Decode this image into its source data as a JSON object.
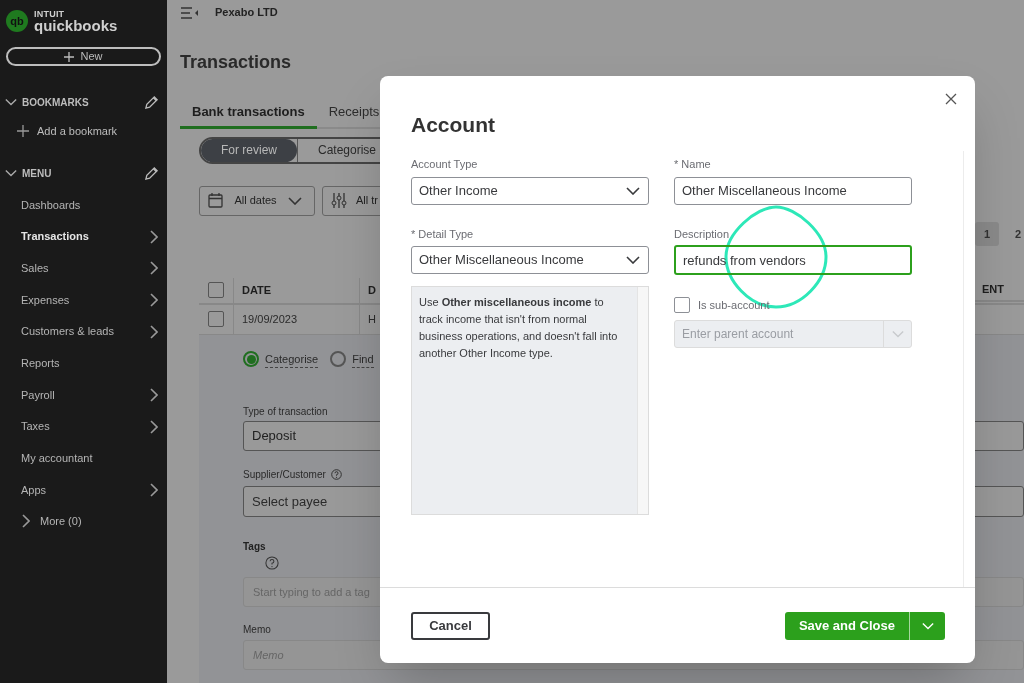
{
  "sidebar": {
    "logo": {
      "brand_small": "INTUIT",
      "brand": "quickbooks",
      "badge": "qb"
    },
    "new_button": "New",
    "bookmarks": {
      "title": "BOOKMARKS",
      "expanded": true,
      "add_label": "Add a bookmark"
    },
    "menu": {
      "title": "MENU",
      "expanded": true,
      "items": [
        {
          "label": "Dashboards",
          "selected": false,
          "has_submenu": false
        },
        {
          "label": "Transactions",
          "selected": true,
          "has_submenu": true
        },
        {
          "label": "Sales",
          "selected": false,
          "has_submenu": true
        },
        {
          "label": "Expenses",
          "selected": false,
          "has_submenu": true
        },
        {
          "label": "Customers & leads",
          "selected": false,
          "has_submenu": true
        },
        {
          "label": "Reports",
          "selected": false,
          "has_submenu": false
        },
        {
          "label": "Payroll",
          "selected": false,
          "has_submenu": true
        },
        {
          "label": "Taxes",
          "selected": false,
          "has_submenu": true
        },
        {
          "label": "My accountant",
          "selected": false,
          "has_submenu": false
        },
        {
          "label": "Apps",
          "selected": false,
          "has_submenu": true
        }
      ],
      "more": "More (0)"
    }
  },
  "topbar": {
    "company": "Pexabo LTD"
  },
  "page": {
    "title": "Transactions",
    "tabs": [
      {
        "label": "Bank transactions",
        "selected": true
      },
      {
        "label": "Receipts",
        "selected": false
      }
    ],
    "segments": [
      {
        "label": "For review",
        "selected": true
      },
      {
        "label": "Categorise",
        "selected": false
      }
    ],
    "filters": [
      {
        "label": "All dates"
      },
      {
        "label": "All tr"
      }
    ],
    "pagination": [
      {
        "label": "1",
        "selected": true
      },
      {
        "label": "2",
        "selected": false
      }
    ],
    "table": {
      "columns": [
        "DATE",
        "D"
      ],
      "right_column": "ENT",
      "all_checked": false,
      "rows": [
        {
          "checked": false,
          "cells": [
            "19/09/2023",
            "H"
          ]
        }
      ]
    },
    "detail": {
      "options": [
        {
          "label": "Categorise",
          "selected": true
        },
        {
          "label": "Find",
          "selected": false
        }
      ],
      "type_label": "Type of transaction",
      "type_value": "Deposit",
      "payee_label": "Supplier/Customer",
      "payee_placeholder": "Select payee",
      "tags_label": "Tags",
      "tags_placeholder": "Start typing to add a tag",
      "memo_label": "Memo",
      "memo_placeholder": "Memo"
    }
  },
  "dialog": {
    "title": "Account",
    "account_type": {
      "label": "Account Type",
      "value": "Other Income"
    },
    "detail_type": {
      "label": "* Detail Type",
      "value": "Other Miscellaneous Income"
    },
    "help_text": "Use **Other miscellaneous income** to track income that isn't from normal business operations, and doesn't fall into another Other Income type.",
    "name": {
      "label": "* Name",
      "value": "Other Miscellaneous Income"
    },
    "description": {
      "label": "Description",
      "value": "refunds from vendors",
      "focused": true
    },
    "sub_account": {
      "label": "Is sub-account",
      "checked": false
    },
    "parent_account": {
      "placeholder": "Enter parent account",
      "disabled": true
    },
    "buttons": {
      "cancel": "Cancel",
      "save": "Save and Close"
    }
  }
}
